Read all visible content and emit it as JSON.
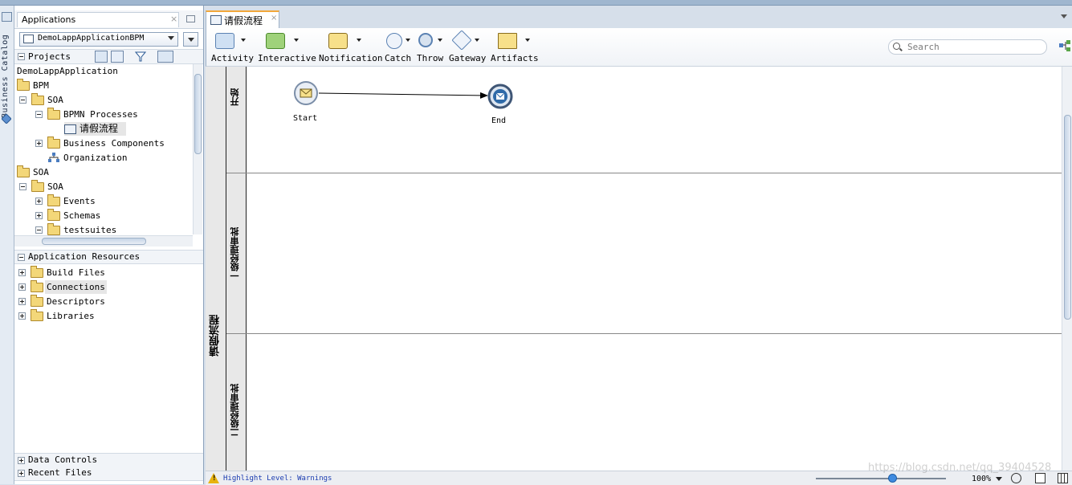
{
  "catalog": {
    "label": "Business Catalog"
  },
  "applications": {
    "title": "Applications",
    "close": "×",
    "selected_app": "DemoLappApplicationBPM"
  },
  "projects": {
    "label": "Projects"
  },
  "tree": {
    "rows": [
      {
        "label": "DemoLappApplication"
      },
      {
        "label": "BPM"
      },
      {
        "label": "SOA"
      },
      {
        "label": "BPMN Processes"
      },
      {
        "label": "请假流程"
      },
      {
        "label": "Business Components"
      },
      {
        "label": "Organization"
      },
      {
        "label": "SOA"
      },
      {
        "label": "SOA"
      },
      {
        "label": "Events"
      },
      {
        "label": "Schemas"
      },
      {
        "label": "testsuites"
      }
    ]
  },
  "resources": {
    "label": "Application Resources",
    "items": [
      {
        "label": "Build Files"
      },
      {
        "label": "Connections"
      },
      {
        "label": "Descriptors"
      },
      {
        "label": "Libraries"
      }
    ]
  },
  "bottom_sections": {
    "data_controls": "Data Controls",
    "recent_files": "Recent Files"
  },
  "editor": {
    "tab_title": "请假流程",
    "tab_close": "×"
  },
  "toolbar": {
    "tools": [
      {
        "label": "Activity",
        "icon": "activity-icon"
      },
      {
        "label": "Interactive",
        "icon": "interactive-icon"
      },
      {
        "label": "Notification",
        "icon": "notification-icon"
      },
      {
        "label": "Catch",
        "icon": "catch-icon"
      },
      {
        "label": "Throw",
        "icon": "throw-icon"
      },
      {
        "label": "Gateway",
        "icon": "gateway-icon"
      },
      {
        "label": "Artifacts",
        "icon": "artifacts-icon"
      }
    ],
    "search_placeholder": "Search"
  },
  "diagram": {
    "pool_title": "请假流程",
    "lanes": [
      {
        "title": "开始"
      },
      {
        "title": "一级经理审批"
      },
      {
        "title": "二级经理审批"
      }
    ],
    "start_label": "Start",
    "end_label": "End"
  },
  "status": {
    "highlight": "Highlight Level: Warnings",
    "zoom": "100%",
    "watermark": "https://blog.csdn.net/qq_39404528"
  },
  "colors": {
    "accent_tab": "#f2a73a",
    "selection": "#e6e6e6",
    "event_blue": "#2f6aa8"
  }
}
